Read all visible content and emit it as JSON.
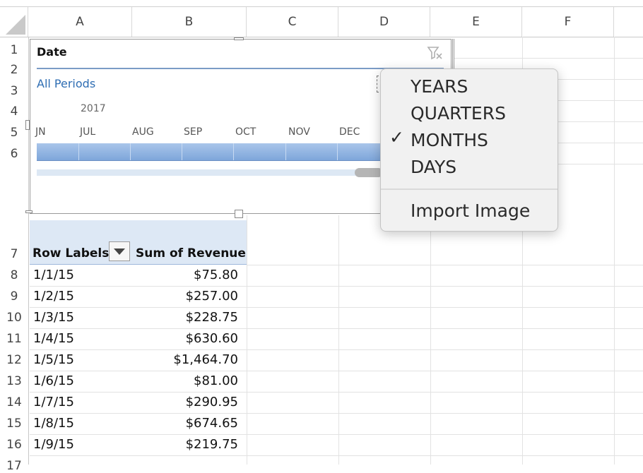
{
  "columns": [
    "A",
    "B",
    "C",
    "D",
    "E",
    "F"
  ],
  "row_numbers": [
    "1",
    "2",
    "3",
    "4",
    "5",
    "6",
    "7",
    "8",
    "9",
    "10",
    "11",
    "12",
    "13",
    "14",
    "15",
    "16",
    "17"
  ],
  "slicer": {
    "title": "Date",
    "filter_icon": "clear-filter-icon",
    "all_periods": "All Periods",
    "year": "2017",
    "months": [
      "JN",
      "JUL",
      "AUG",
      "SEP",
      "OCT",
      "NOV",
      "DEC"
    ]
  },
  "pivot": {
    "row_labels": "Row Labels",
    "sum_header": "Sum of Revenue",
    "rows": [
      {
        "date": "1/1/15",
        "value": "$75.80"
      },
      {
        "date": "1/2/15",
        "value": "$257.00"
      },
      {
        "date": "1/3/15",
        "value": "$228.75"
      },
      {
        "date": "1/4/15",
        "value": "$630.60"
      },
      {
        "date": "1/5/15",
        "value": "$1,464.70"
      },
      {
        "date": "1/6/15",
        "value": "$81.00"
      },
      {
        "date": "1/7/15",
        "value": "$290.95"
      },
      {
        "date": "1/8/15",
        "value": "$674.65"
      },
      {
        "date": "1/9/15",
        "value": "$219.75"
      }
    ]
  },
  "menu": {
    "items": [
      "YEARS",
      "QUARTERS",
      "MONTHS",
      "DAYS"
    ],
    "checkmark": "✓",
    "checked": "MONTHS",
    "import": "Import Image"
  }
}
